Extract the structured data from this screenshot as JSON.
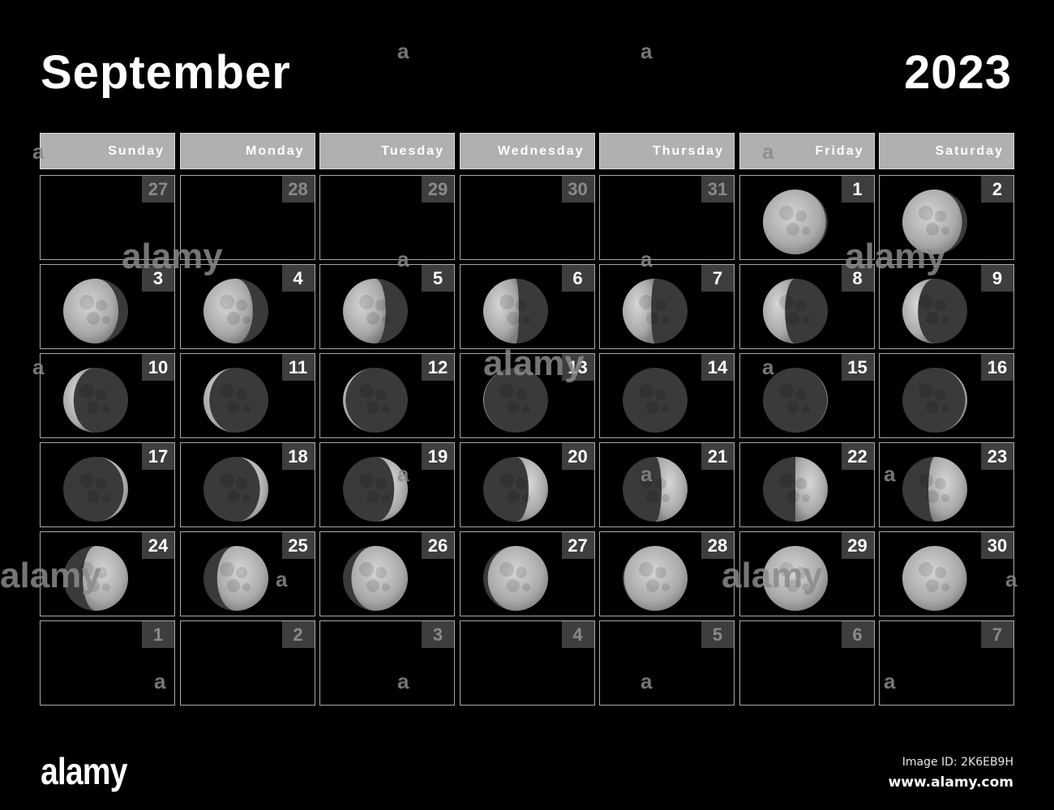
{
  "header": {
    "month": "September",
    "year": "2023"
  },
  "weekdays": [
    "Sunday",
    "Monday",
    "Tuesday",
    "Wednesday",
    "Thursday",
    "Friday",
    "Saturday"
  ],
  "days": [
    {
      "n": "27",
      "other": true
    },
    {
      "n": "28",
      "other": true
    },
    {
      "n": "29",
      "other": true
    },
    {
      "n": "30",
      "other": true
    },
    {
      "n": "31",
      "other": true
    },
    {
      "n": "1",
      "phase": 0.97,
      "waxing": false
    },
    {
      "n": "2",
      "phase": 0.92,
      "waxing": false
    },
    {
      "n": "3",
      "phase": 0.85,
      "waxing": false
    },
    {
      "n": "4",
      "phase": 0.76,
      "waxing": false
    },
    {
      "n": "5",
      "phase": 0.66,
      "waxing": false
    },
    {
      "n": "6",
      "phase": 0.55,
      "waxing": false
    },
    {
      "n": "7",
      "phase": 0.44,
      "waxing": false
    },
    {
      "n": "8",
      "phase": 0.34,
      "waxing": false
    },
    {
      "n": "9",
      "phase": 0.24,
      "waxing": false
    },
    {
      "n": "10",
      "phase": 0.16,
      "waxing": false
    },
    {
      "n": "11",
      "phase": 0.09,
      "waxing": false
    },
    {
      "n": "12",
      "phase": 0.04,
      "waxing": false
    },
    {
      "n": "13",
      "phase": 0.01,
      "waxing": false
    },
    {
      "n": "14",
      "phase": 0.0,
      "waxing": true
    },
    {
      "n": "15",
      "phase": 0.01,
      "waxing": true
    },
    {
      "n": "16",
      "phase": 0.03,
      "waxing": true
    },
    {
      "n": "17",
      "phase": 0.07,
      "waxing": true
    },
    {
      "n": "18",
      "phase": 0.13,
      "waxing": true
    },
    {
      "n": "19",
      "phase": 0.21,
      "waxing": true
    },
    {
      "n": "20",
      "phase": 0.3,
      "waxing": true
    },
    {
      "n": "21",
      "phase": 0.4,
      "waxing": true
    },
    {
      "n": "22",
      "phase": 0.5,
      "waxing": true
    },
    {
      "n": "23",
      "phase": 0.6,
      "waxing": true
    },
    {
      "n": "24",
      "phase": 0.7,
      "waxing": true
    },
    {
      "n": "25",
      "phase": 0.79,
      "waxing": true
    },
    {
      "n": "26",
      "phase": 0.87,
      "waxing": true
    },
    {
      "n": "27",
      "phase": 0.93,
      "waxing": true
    },
    {
      "n": "28",
      "phase": 0.98,
      "waxing": true
    },
    {
      "n": "29",
      "phase": 1.0,
      "waxing": true
    },
    {
      "n": "30",
      "phase": 0.99,
      "waxing": false
    },
    {
      "n": "1",
      "other": true
    },
    {
      "n": "2",
      "other": true
    },
    {
      "n": "3",
      "other": true
    },
    {
      "n": "4",
      "other": true
    },
    {
      "n": "5",
      "other": true
    },
    {
      "n": "6",
      "other": true
    },
    {
      "n": "7",
      "other": true
    }
  ],
  "footer": {
    "logo": "alamy",
    "image_id": "Image ID: 2K6EB9H",
    "url": "www.alamy.com"
  },
  "watermark": {
    "text": "alamy",
    "glyph": "a"
  }
}
